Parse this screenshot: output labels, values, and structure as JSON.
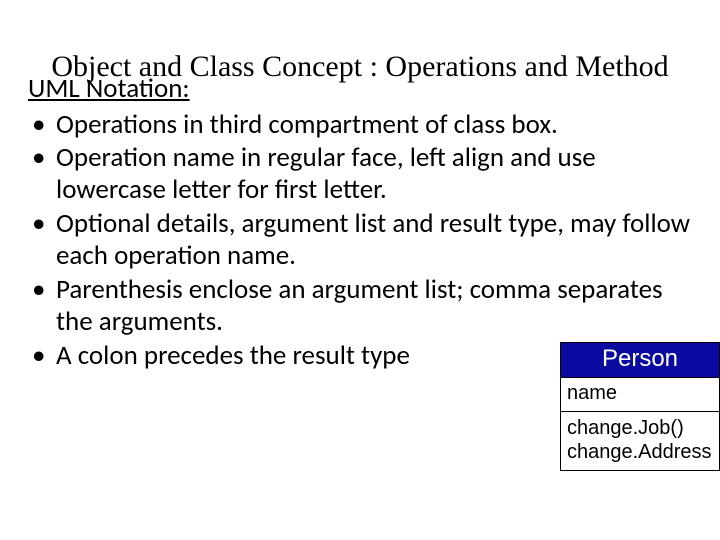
{
  "title": "Object and Class Concept : Operations and Method",
  "subheading": "UML Notation:",
  "bullets": [
    "Operations in third compartment of class box.",
    "Operation name in regular face, left align and use lowercase letter for first letter.",
    "Optional details, argument list and result type, may follow each operation name.",
    "Parenthesis enclose an argument list; comma separates the arguments.",
    "A colon precedes the result type"
  ],
  "uml": {
    "class_name": "Person",
    "attributes": [
      "name"
    ],
    "operations": [
      "change.Job()",
      "change.Address"
    ]
  }
}
